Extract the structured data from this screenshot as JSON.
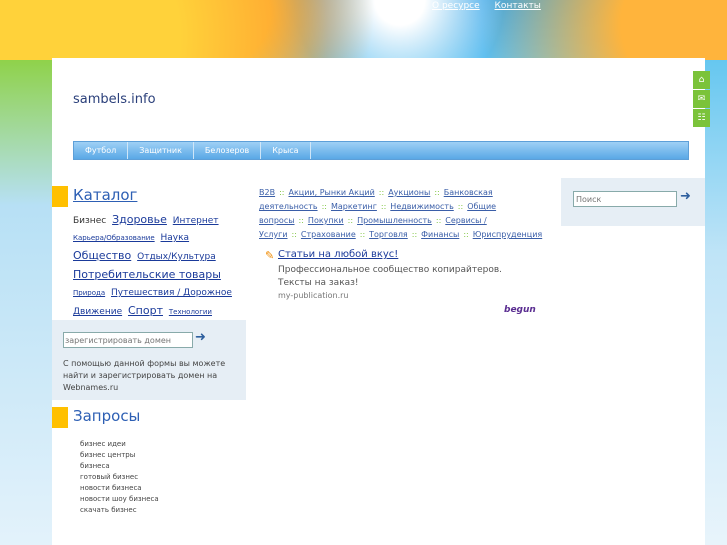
{
  "top_links": [
    "О ресурсе",
    "Контакты"
  ],
  "site_title": "sambels.info",
  "nav": [
    "Футбол",
    "Защитник",
    "Белозеров",
    "Крыса"
  ],
  "side_icons": [
    "home-icon",
    "mail-icon",
    "sitemap-icon"
  ],
  "catalog": {
    "title": "Каталог",
    "items": [
      {
        "text": "Бизнес",
        "size": "m",
        "link": false
      },
      {
        "text": "Здоровье",
        "size": "l",
        "link": true
      },
      {
        "text": "Интернет",
        "size": "m",
        "link": true
      },
      {
        "text": "Карьера/Образование",
        "size": "s",
        "link": true
      },
      {
        "text": "Наука",
        "size": "m",
        "link": true
      },
      {
        "text": "Общество",
        "size": "l",
        "link": true
      },
      {
        "text": "Отдых/Культура",
        "size": "m",
        "link": true
      },
      {
        "text": "Потребительские товары",
        "size": "l",
        "link": true
      },
      {
        "text": "Природа",
        "size": "s",
        "link": true
      },
      {
        "text": "Путешествия / Дорожное",
        "size": "m",
        "link": true
      },
      {
        "text": "Движение",
        "size": "m",
        "link": true
      },
      {
        "text": "Спорт",
        "size": "l",
        "link": true
      },
      {
        "text": "Технологии",
        "size": "s",
        "link": true
      }
    ]
  },
  "domain_form": {
    "placeholder": "зарегистрировать домен",
    "description": "С помощью данной формы вы можете найти и зарегистрировать домен на Webnames.ru"
  },
  "queries": {
    "title": "Запросы",
    "items": [
      "бизнес идеи",
      "бизнес центры",
      "бизнеса",
      "готовый бизнес",
      "новости бизнеса",
      "новости шоу бизнеса",
      "скачать бизнес"
    ]
  },
  "categories": [
    "B2B",
    "Акции, Рынки Акций",
    "Аукционы",
    "Банковская деятельность",
    "Маркетинг",
    "Недвижимость",
    "Общие вопросы",
    "Покупки",
    "Промышленность",
    "Сервисы /Услуги",
    "Страхование",
    "Торговля",
    "Финансы",
    "Юриспруденция"
  ],
  "ad": {
    "title": "Статьи на любой вкус!",
    "text": "Профессиональное сообщество копирайтеров. Тексты на заказ!",
    "url": "my-publication.ru"
  },
  "begun_label": "begun",
  "search": {
    "placeholder": "Поиск"
  }
}
